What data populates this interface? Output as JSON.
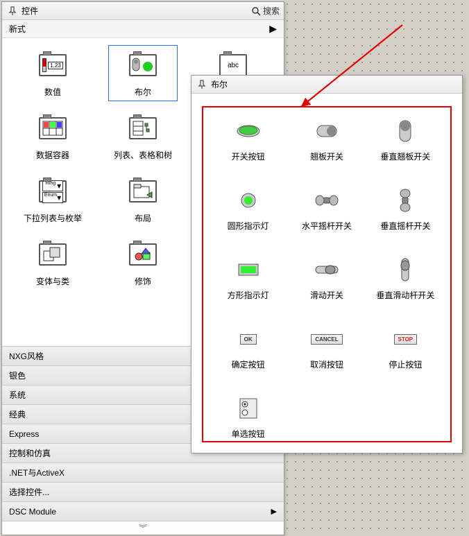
{
  "main_panel": {
    "title": "控件",
    "search_label": "搜索",
    "subheader": "新式",
    "palette_items": [
      {
        "label": "数值",
        "icon": "numeric-icon"
      },
      {
        "label": "布尔",
        "icon": "boolean-icon",
        "selected": true
      },
      {
        "label": "abc",
        "icon": "string-icon"
      },
      {
        "label": "数据容器",
        "icon": "data-container-icon"
      },
      {
        "label": "列表、表格和树",
        "icon": "list-table-tree-icon"
      },
      {
        "label": "",
        "icon": ""
      },
      {
        "label": "下拉列表与枚举",
        "icon": "ring-enum-icon"
      },
      {
        "label": "布局",
        "icon": "layout-icon"
      },
      {
        "label": "",
        "icon": ""
      },
      {
        "label": "变体与类",
        "icon": "variant-class-icon"
      },
      {
        "label": "修饰",
        "icon": "decoration-icon"
      },
      {
        "label": "",
        "icon": ""
      }
    ],
    "categories": [
      {
        "label": "NXG风格",
        "has_sub": false
      },
      {
        "label": "银色",
        "has_sub": false
      },
      {
        "label": "系统",
        "has_sub": false
      },
      {
        "label": "经典",
        "has_sub": false
      },
      {
        "label": "Express",
        "has_sub": false
      },
      {
        "label": "控制和仿真",
        "has_sub": false
      },
      {
        "label": ".NET与ActiveX",
        "has_sub": false
      },
      {
        "label": "选择控件...",
        "has_sub": false
      },
      {
        "label": "DSC Module",
        "has_sub": true
      }
    ],
    "footer_glyph": "︾"
  },
  "sub_panel": {
    "title": "布尔",
    "items": [
      {
        "label": "开关按钮",
        "icon": "push-button-icon"
      },
      {
        "label": "翘板开关",
        "icon": "rocker-switch-icon"
      },
      {
        "label": "垂直翘板开关",
        "icon": "vert-rocker-icon"
      },
      {
        "label": "圆形指示灯",
        "icon": "round-led-icon"
      },
      {
        "label": "水平摇杆开关",
        "icon": "horiz-toggle-icon"
      },
      {
        "label": "垂直摇杆开关",
        "icon": "vert-toggle-icon"
      },
      {
        "label": "方形指示灯",
        "icon": "square-led-icon"
      },
      {
        "label": "滑动开关",
        "icon": "slide-switch-icon"
      },
      {
        "label": "垂直滑动杆开关",
        "icon": "vert-slide-switch-icon"
      },
      {
        "label": "确定按钮",
        "icon": "ok-button-icon",
        "text": "OK"
      },
      {
        "label": "取消按钮",
        "icon": "cancel-button-icon",
        "text": "CANCEL"
      },
      {
        "label": "停止按钮",
        "icon": "stop-button-icon",
        "text": "STOP"
      },
      {
        "label": "单选按钮",
        "icon": "radio-button-icon"
      }
    ]
  }
}
